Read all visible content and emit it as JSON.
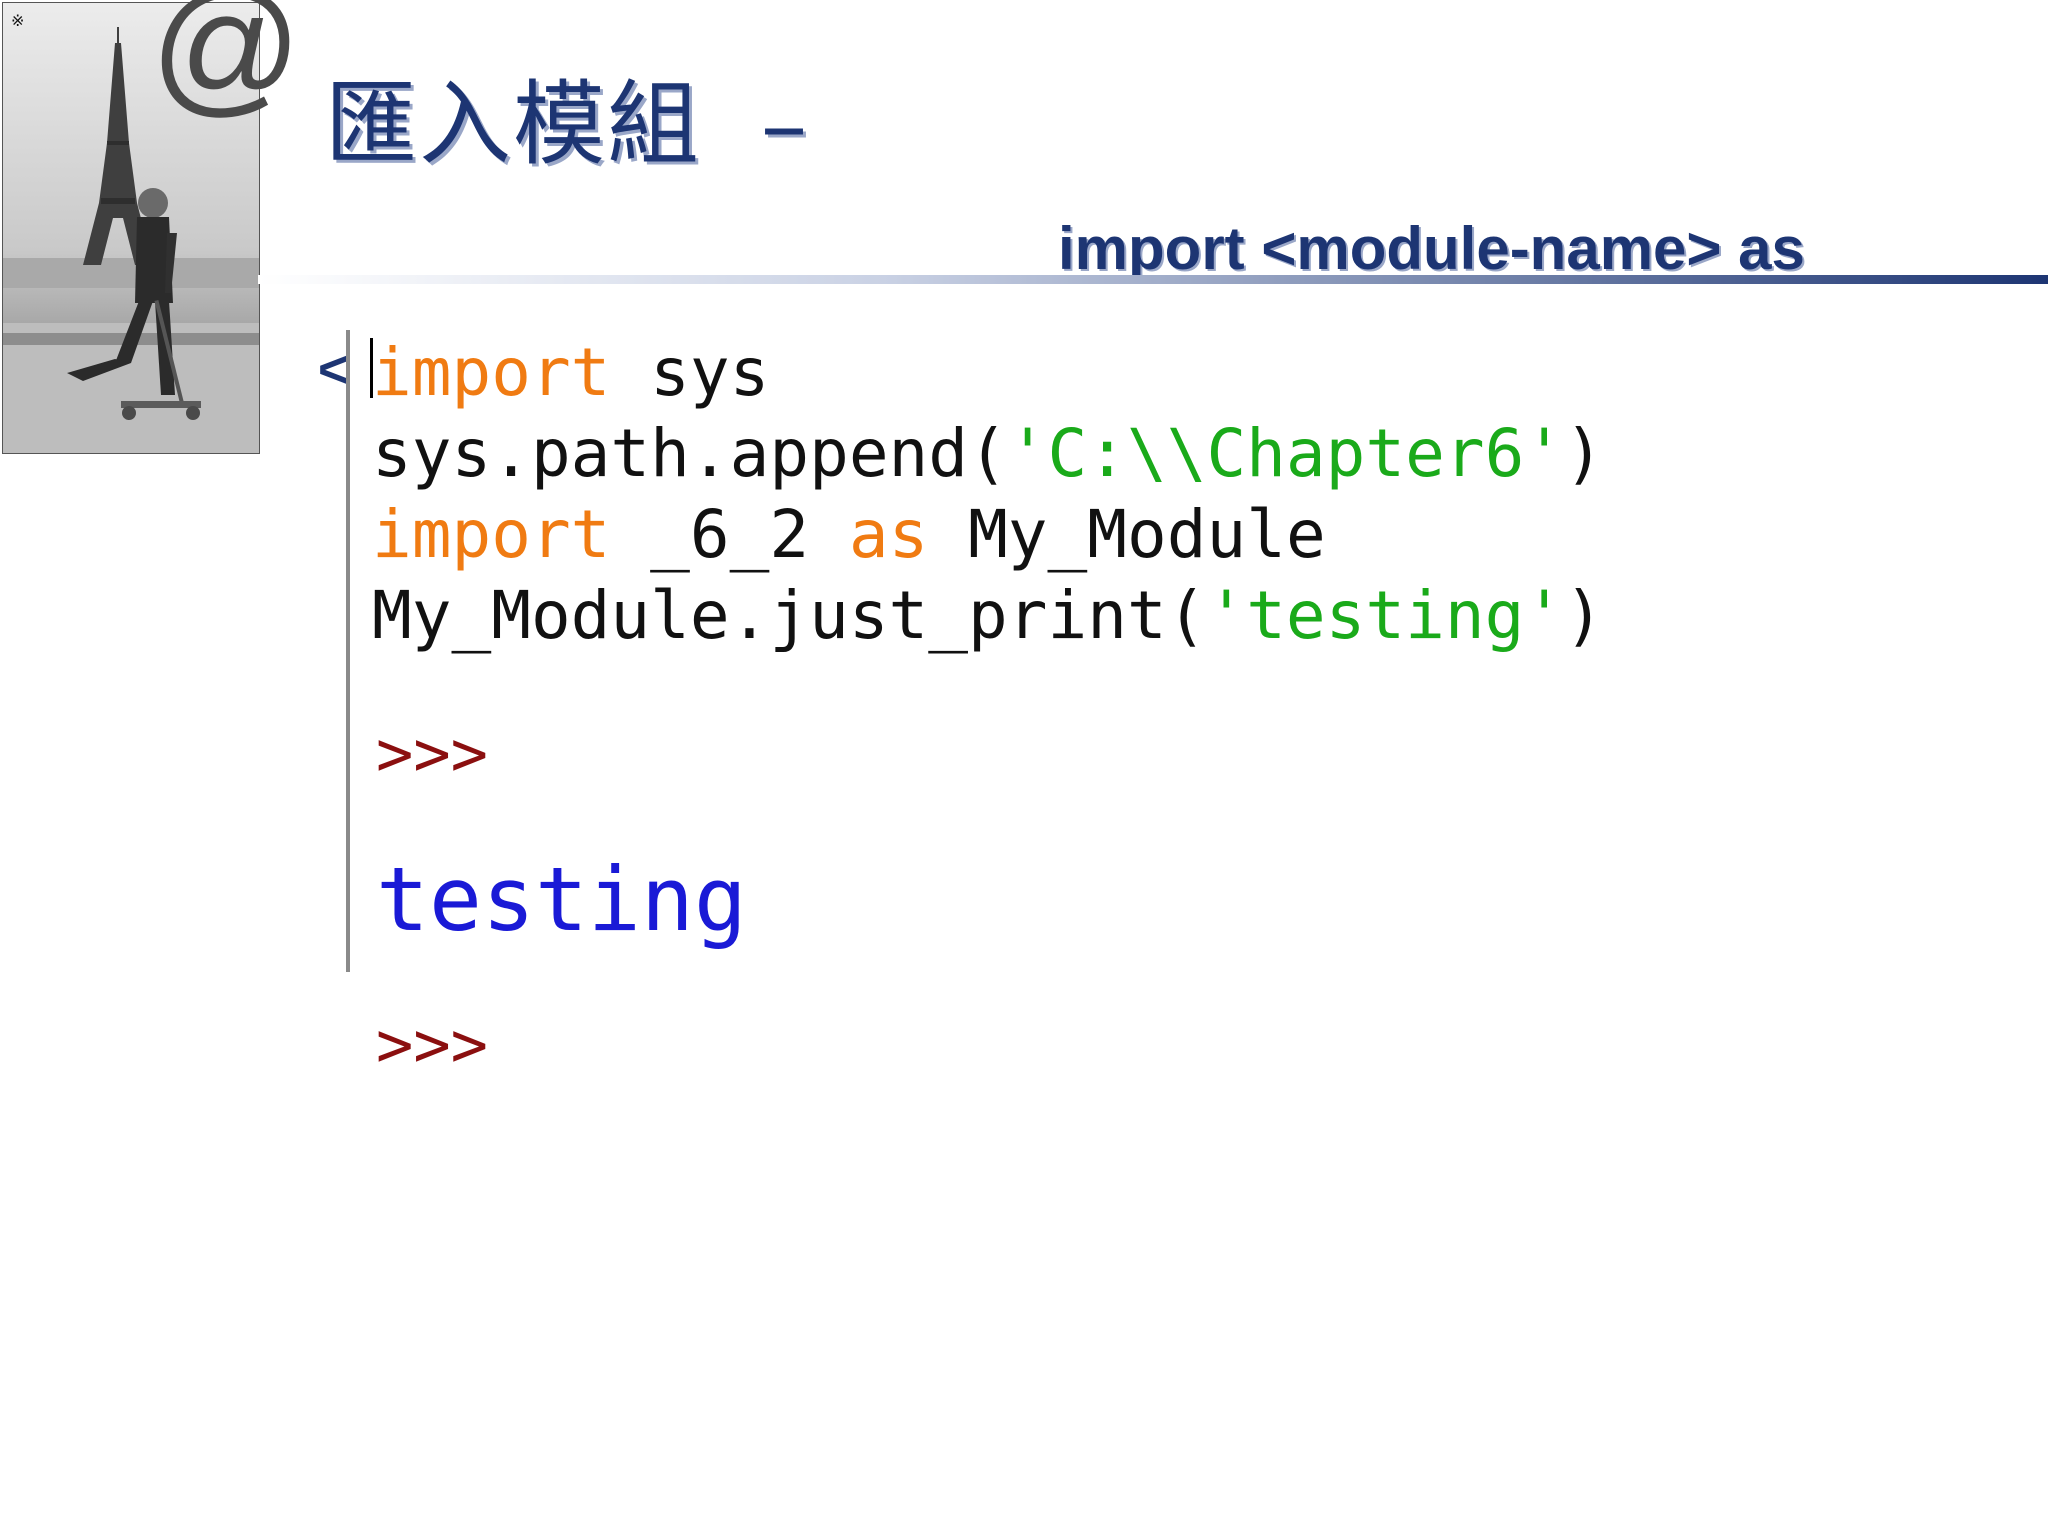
{
  "slide": {
    "title": "匯入模組",
    "title_dash": "–",
    "subtitle": "import <module-name> as",
    "bullet_glyph": "<",
    "photo": {
      "icon": "eiffel-tower-scooter-photo",
      "corner_glyph": "※",
      "at_sign": "@"
    }
  },
  "code": {
    "lines": [
      [
        {
          "text": "import",
          "kind": "keyword"
        },
        {
          "text": " sys",
          "kind": "plain"
        }
      ],
      [
        {
          "text": "sys.path.append(",
          "kind": "plain"
        },
        {
          "text": "'C:\\\\Chapter6'",
          "kind": "string"
        },
        {
          "text": ")",
          "kind": "plain"
        }
      ],
      [
        {
          "text": "import",
          "kind": "keyword"
        },
        {
          "text": " _6_2 ",
          "kind": "plain"
        },
        {
          "text": "as",
          "kind": "keyword"
        },
        {
          "text": " My_Module",
          "kind": "plain"
        }
      ],
      [
        {
          "text": "My_Module.just_print(",
          "kind": "plain"
        },
        {
          "text": "'testing'",
          "kind": "string"
        },
        {
          "text": ")",
          "kind": "plain"
        }
      ]
    ]
  },
  "shell": {
    "prompt1": ">>>",
    "output": "testing",
    "prompt2": ">>>"
  },
  "colors": {
    "title": "#1d3573",
    "keyword": "#f07b12",
    "string": "#1aaa1a",
    "prompt": "#8b0f0f",
    "output": "#1a1ad6"
  }
}
